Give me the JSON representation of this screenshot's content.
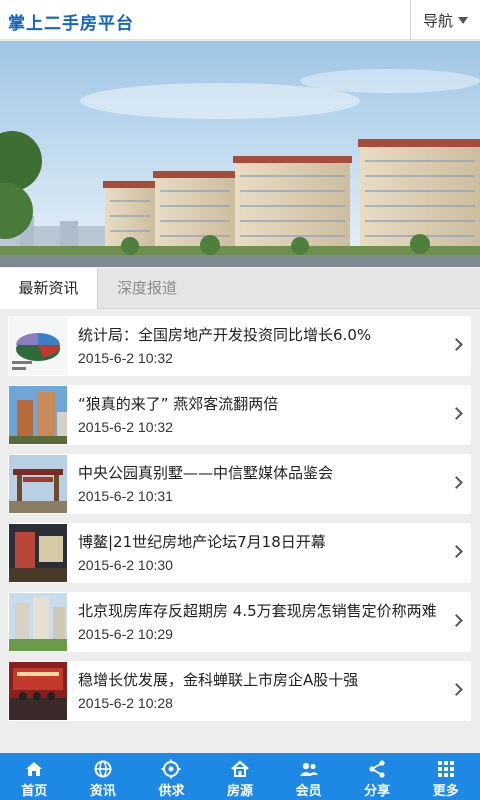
{
  "header": {
    "title": "掌上二手房平台",
    "nav_label": "导航"
  },
  "tabs": [
    {
      "label": "最新资讯",
      "active": true
    },
    {
      "label": "深度报道",
      "active": false
    }
  ],
  "news": [
    {
      "title": "统计局：全国房地产开发投资同比增长6.0%",
      "date": "2015-6-2 10:32",
      "thumb": "pie-chart-thumbnail"
    },
    {
      "title": "“狼真的来了” 燕郊客流翻两倍",
      "date": "2015-6-2 10:32",
      "thumb": "building-thumbnail"
    },
    {
      "title": "中央公园真别墅——中信墅媒体品鉴会",
      "date": "2015-6-2 10:31",
      "thumb": "gate-thumbnail"
    },
    {
      "title": "博鳌|21世纪房地产论坛7月18日开幕",
      "date": "2015-6-2 10:30",
      "thumb": "forum-thumbnail"
    },
    {
      "title": "北京现房库存反超期房 4.5万套现房怎销售定价称两难",
      "date": "2015-6-2 10:29",
      "thumb": "apartments-thumbnail"
    },
    {
      "title": "稳增长优发展，金科蝉联上市房企A股十强",
      "date": "2015-6-2 10:28",
      "thumb": "stage-thumbnail"
    }
  ],
  "footer": [
    {
      "label": "首页",
      "icon": "home-icon"
    },
    {
      "label": "资讯",
      "icon": "globe-icon"
    },
    {
      "label": "供求",
      "icon": "target-icon"
    },
    {
      "label": "房源",
      "icon": "house-icon"
    },
    {
      "label": "会员",
      "icon": "users-icon"
    },
    {
      "label": "分享",
      "icon": "share-icon"
    },
    {
      "label": "更多",
      "icon": "grid-icon"
    }
  ],
  "colors": {
    "brand": "#1565c0",
    "footer": "#1e88e5"
  }
}
